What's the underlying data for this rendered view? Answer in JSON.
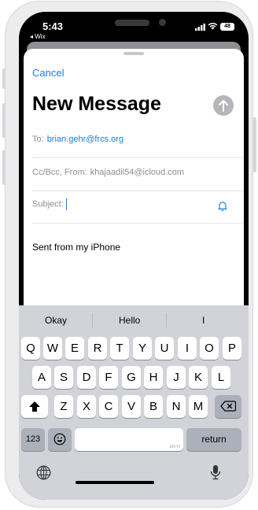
{
  "status": {
    "time": "5:43",
    "back_app": "◂ Wix",
    "battery": "48"
  },
  "compose": {
    "cancel": "Cancel",
    "title": "New Message",
    "to_label": "To:",
    "to_value": "brian.gehr@frcs.org",
    "ccbcc_label": "Cc/Bcc, From:",
    "from_value": "khajaadil54@icloud.com",
    "subject_label": "Subject:",
    "subject_value": "",
    "body": "Sent from my iPhone"
  },
  "keyboard": {
    "suggestions": [
      "Okay",
      "Hello",
      "I"
    ],
    "row1": [
      "Q",
      "W",
      "E",
      "R",
      "T",
      "Y",
      "U",
      "I",
      "O",
      "P"
    ],
    "row2": [
      "A",
      "S",
      "D",
      "F",
      "G",
      "H",
      "J",
      "K",
      "L"
    ],
    "row3": [
      "Z",
      "X",
      "C",
      "V",
      "B",
      "N",
      "M"
    ],
    "numbers_key": "123",
    "return_key": "return",
    "space_hint": "EN VI"
  },
  "icons": [
    "shift-icon",
    "backspace-icon",
    "emoji-icon",
    "globe-icon",
    "mic-icon",
    "send-icon",
    "bell-icon"
  ],
  "colors": {
    "accent": "#1a7de6",
    "keyboard_bg": "#d1d3d9",
    "send_disabled": "#b6b6ba"
  }
}
